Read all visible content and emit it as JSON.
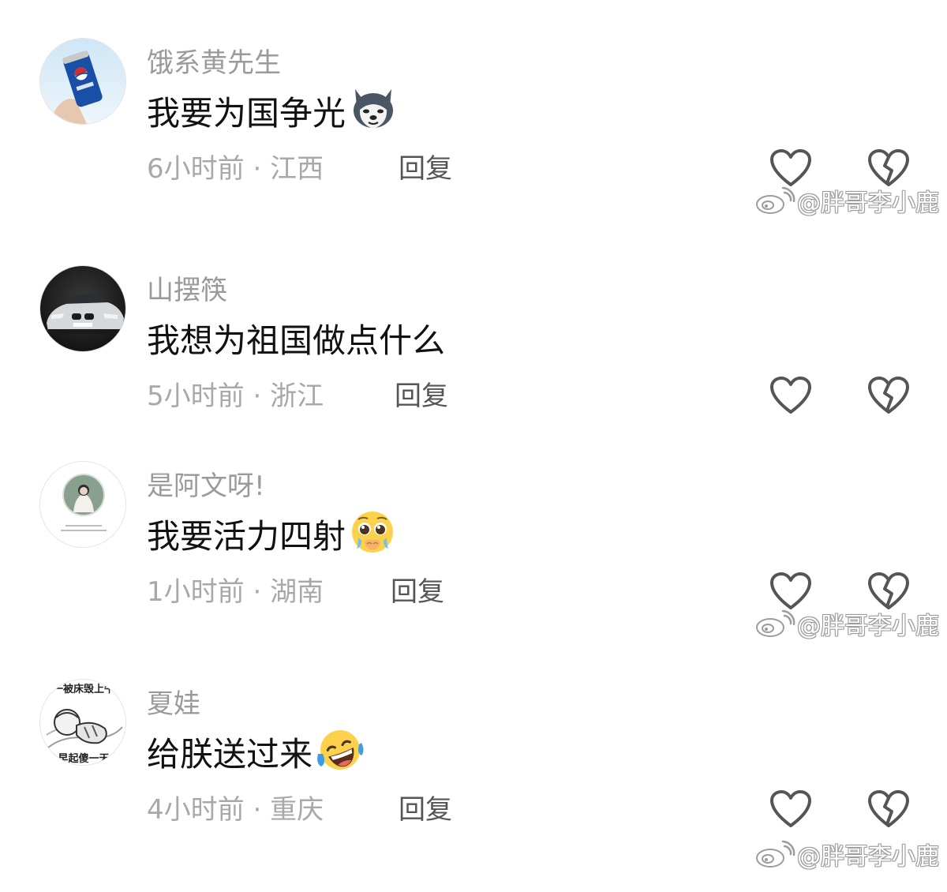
{
  "comments": [
    {
      "username": "饿系黄先生",
      "text": "我要为国争光",
      "time": "6小时前",
      "separator": "·",
      "location": "江西",
      "reply_label": "回复",
      "emoji": "husky-dog-emoji",
      "avatar": "pepsi-can-avatar"
    },
    {
      "username": "山摆筷",
      "text": "我想为祖国做点什么",
      "time": "5小时前",
      "separator": "·",
      "location": "浙江",
      "reply_label": "回复",
      "emoji": "",
      "avatar": "sports-car-avatar"
    },
    {
      "username": "是阿文呀!",
      "text": "我要活力四射",
      "time": "1小时前",
      "separator": "·",
      "location": "湖南",
      "reply_label": "回复",
      "emoji": "pleading-face-emoji",
      "avatar": "portrait-circle-avatar"
    },
    {
      "username": "夏娃",
      "text": "给朕送过来",
      "time": "4小时前",
      "separator": "·",
      "location": "重庆",
      "reply_label": "回复",
      "emoji": "laughing-crying-face-emoji",
      "avatar": "sketch-baby-avatar",
      "avatar_text_top": "一被床毁上午",
      "avatar_text_bottom": "早起傻一天"
    }
  ],
  "watermark": {
    "text": "@胖哥李小鹿",
    "logo": "weibo-logo-icon"
  },
  "icons": {
    "like": "heart-outline-icon",
    "dislike": "broken-heart-outline-icon"
  },
  "colors": {
    "background": "#ffffff",
    "username": "#9a9a9a",
    "text": "#111111",
    "meta": "#a8a8a8",
    "reply": "#555555",
    "icon": "#555555"
  }
}
